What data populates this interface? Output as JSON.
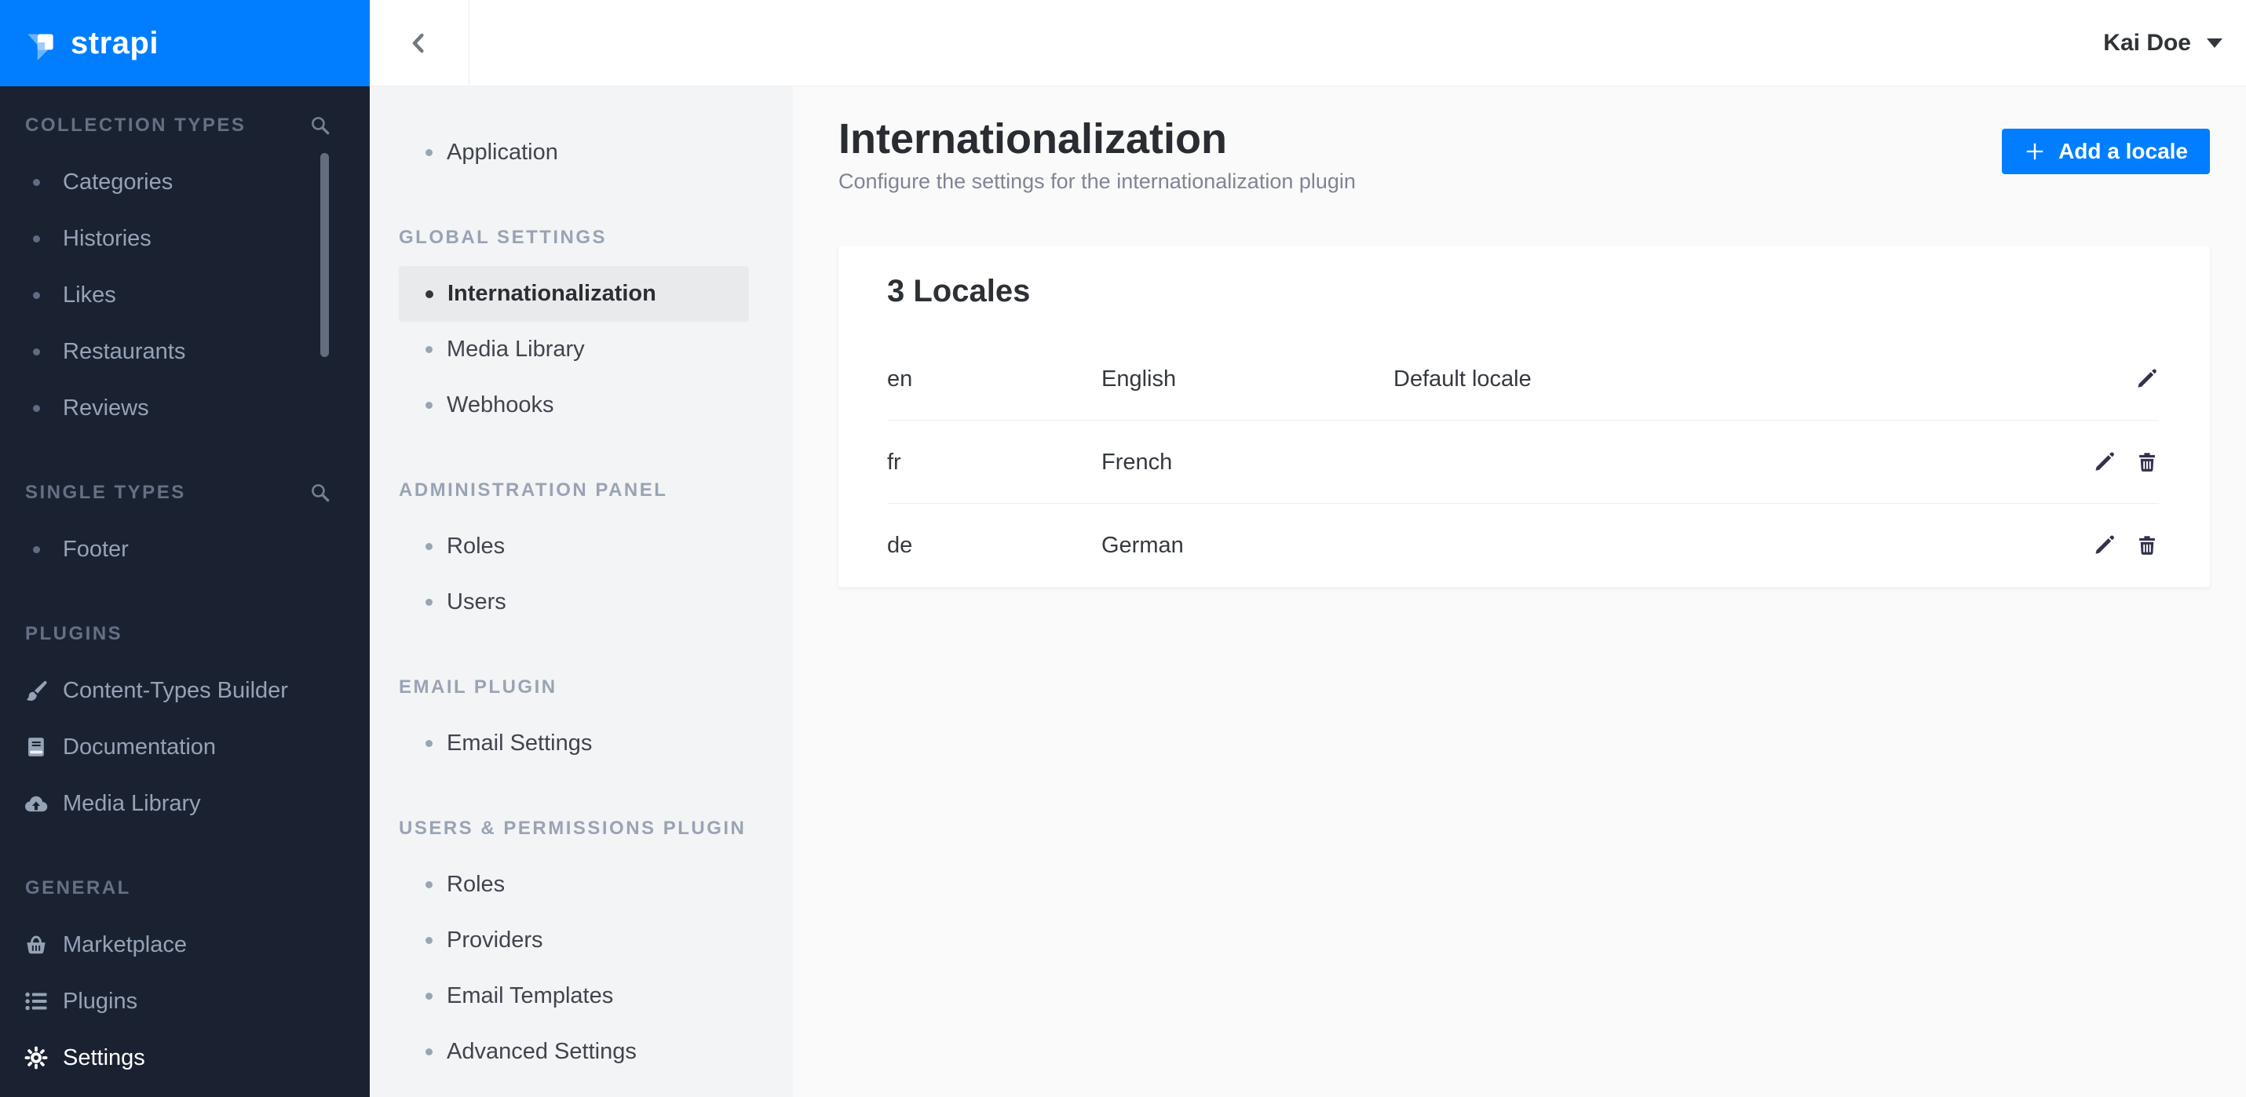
{
  "brand": {
    "logo_text": "strapi"
  },
  "header": {
    "user_name": "Kai Doe"
  },
  "colors": {
    "accent": "#007eff",
    "sidebar_bg": "#1a2232",
    "settings_nav_bg": "#f3f4f6",
    "active_item_bg": "#e9eaeb",
    "content_bg": "#fafafb"
  },
  "sidebar": {
    "sections": [
      {
        "title": "COLLECTION TYPES",
        "has_search": true,
        "items": [
          {
            "label": "Categories"
          },
          {
            "label": "Histories"
          },
          {
            "label": "Likes"
          },
          {
            "label": "Restaurants"
          },
          {
            "label": "Reviews"
          }
        ]
      },
      {
        "title": "SINGLE TYPES",
        "has_search": true,
        "items": [
          {
            "label": "Footer"
          }
        ]
      },
      {
        "title": "PLUGINS",
        "items": [
          {
            "label": "Content-Types Builder",
            "icon": "paintbrush-icon"
          },
          {
            "label": "Documentation",
            "icon": "book-icon"
          },
          {
            "label": "Media Library",
            "icon": "cloud-upload-icon"
          }
        ]
      },
      {
        "title": "GENERAL",
        "items": [
          {
            "label": "Marketplace",
            "icon": "basket-icon"
          },
          {
            "label": "Plugins",
            "icon": "list-icon"
          },
          {
            "label": "Settings",
            "icon": "gear-icon",
            "active": true
          }
        ]
      }
    ]
  },
  "settings_nav": {
    "sections": [
      {
        "title": "",
        "items": [
          {
            "label": "Application"
          }
        ]
      },
      {
        "title": "GLOBAL SETTINGS",
        "items": [
          {
            "label": "Internationalization",
            "active": true
          },
          {
            "label": "Media Library"
          },
          {
            "label": "Webhooks"
          }
        ]
      },
      {
        "title": "ADMINISTRATION PANEL",
        "items": [
          {
            "label": "Roles"
          },
          {
            "label": "Users"
          }
        ]
      },
      {
        "title": "EMAIL PLUGIN",
        "items": [
          {
            "label": "Email Settings"
          }
        ]
      },
      {
        "title": "USERS & PERMISSIONS PLUGIN",
        "items": [
          {
            "label": "Roles"
          },
          {
            "label": "Providers"
          },
          {
            "label": "Email Templates"
          },
          {
            "label": "Advanced Settings"
          }
        ]
      }
    ]
  },
  "page": {
    "title": "Internationalization",
    "subtitle": "Configure the settings for the internationalization plugin",
    "add_button_label": "Add a locale"
  },
  "locales": {
    "card_title": "3 Locales",
    "rows": [
      {
        "code": "en",
        "name": "English",
        "note": "Default locale",
        "can_delete": false
      },
      {
        "code": "fr",
        "name": "French",
        "note": "",
        "can_delete": true
      },
      {
        "code": "de",
        "name": "German",
        "note": "",
        "can_delete": true
      }
    ]
  }
}
